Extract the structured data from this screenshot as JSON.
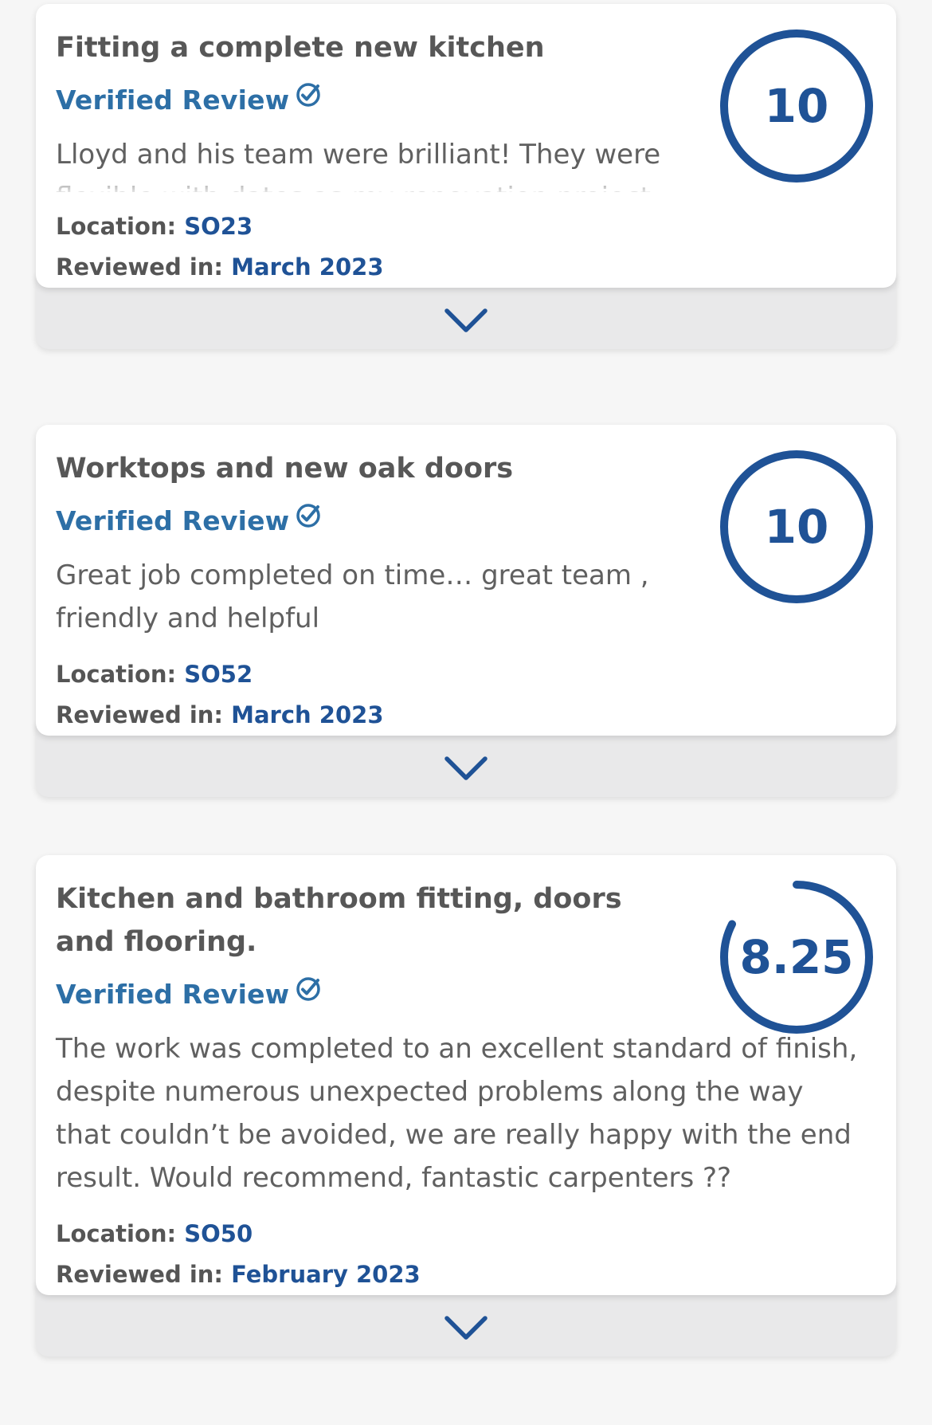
{
  "colors": {
    "brand_blue": "#1f5296",
    "verified_blue": "#2d6fa6",
    "text_gray": "#606060",
    "card_bg": "#ffffff",
    "expand_bar_bg": "#e9e9ea"
  },
  "reviews": [
    {
      "title": "Fitting a complete new kitchen",
      "verified_label": "Verified Review",
      "verified_icon": "verified-check-icon",
      "text": "Lloyd and his team were brilliant! They were flexible with dates as my renovation project ran",
      "location_label": "Location:",
      "location": "SO23",
      "reviewed_label": "Reviewed in:",
      "reviewed_date": "March 2023",
      "score": "10",
      "score_fraction": 1.0,
      "expand_icon": "chevron-down-icon"
    },
    {
      "title": "Worktops and new oak doors",
      "verified_label": "Verified Review",
      "verified_icon": "verified-check-icon",
      "text": "Great job completed on time… great team , friendly and helpful",
      "location_label": "Location:",
      "location": "SO52",
      "reviewed_label": "Reviewed in:",
      "reviewed_date": "March 2023",
      "score": "10",
      "score_fraction": 1.0,
      "expand_icon": "chevron-down-icon"
    },
    {
      "title": "Kitchen and bathroom fitting, doors and flooring.",
      "verified_label": "Verified Review",
      "verified_icon": "verified-check-icon",
      "text": "The work was completed to an excellent standard of finish, despite numerous unexpected problems along the way that couldn’t be avoided, we are really happy with the end result. Would recommend, fantastic carpenters ??",
      "location_label": "Location:",
      "location": "SO50",
      "reviewed_label": "Reviewed in:",
      "reviewed_date": "February 2023",
      "score": "8.25",
      "score_fraction": 0.825,
      "expand_icon": "chevron-down-icon"
    }
  ]
}
